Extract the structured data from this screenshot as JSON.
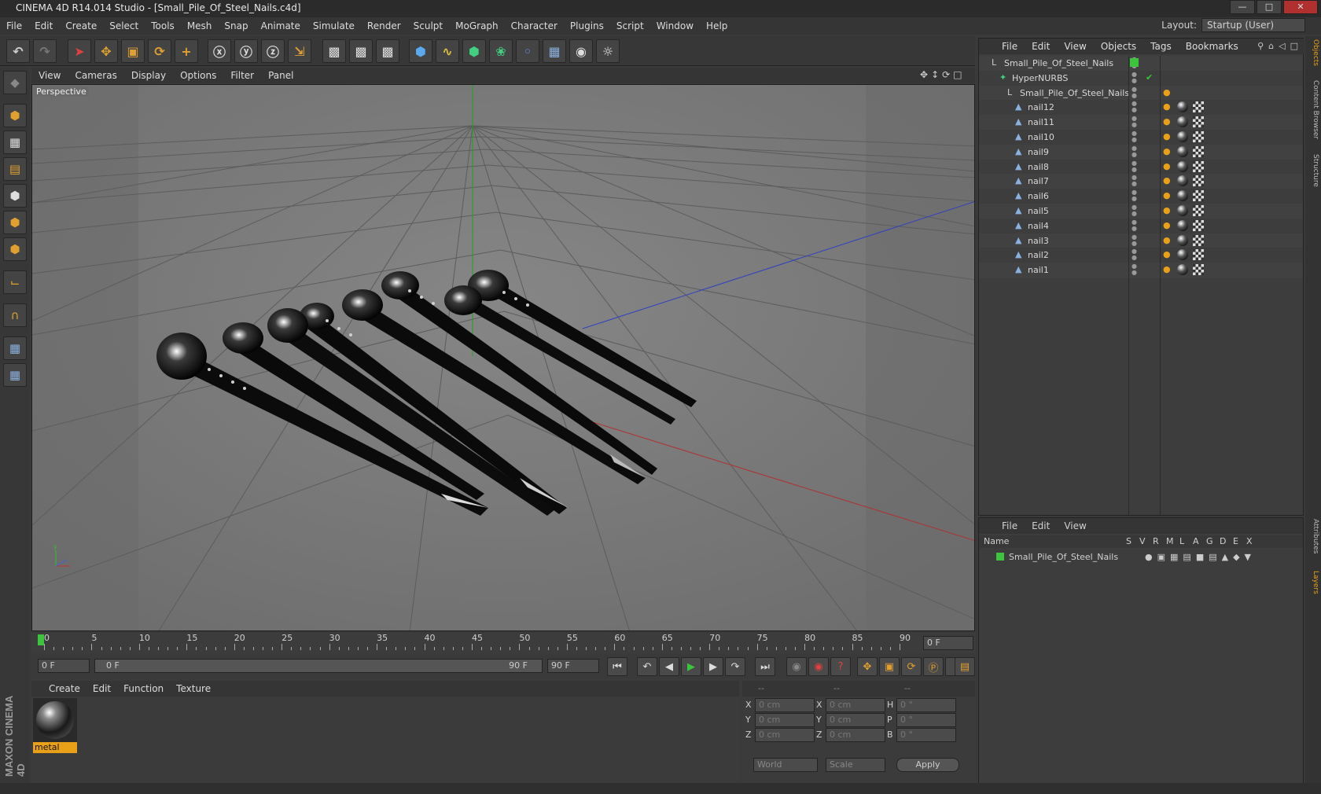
{
  "title": "CINEMA 4D R14.014 Studio - [Small_Pile_Of_Steel_Nails.c4d]",
  "menu": [
    "File",
    "Edit",
    "Create",
    "Select",
    "Tools",
    "Mesh",
    "Snap",
    "Animate",
    "Simulate",
    "Render",
    "Sculpt",
    "MoGraph",
    "Character",
    "Plugins",
    "Script",
    "Window",
    "Help"
  ],
  "layout": {
    "label": "Layout:",
    "value": "Startup (User)"
  },
  "viewport": {
    "menu": [
      "View",
      "Cameras",
      "Display",
      "Options",
      "Filter",
      "Panel"
    ],
    "label": "Perspective"
  },
  "timeline": {
    "ticks": [
      "0",
      "5",
      "10",
      "15",
      "20",
      "25",
      "30",
      "35",
      "40",
      "45",
      "50",
      "55",
      "60",
      "65",
      "70",
      "75",
      "80",
      "85",
      "90"
    ],
    "current_frame": "0 F"
  },
  "playback": {
    "start": "0 F",
    "range_start": "0 F",
    "range_end": "90 F",
    "end": "90 F"
  },
  "materials": {
    "menu": [
      "Create",
      "Edit",
      "Function",
      "Texture"
    ],
    "items": [
      {
        "name": "metal"
      }
    ]
  },
  "coords": {
    "headers": [
      "--",
      "--",
      "--"
    ],
    "rows": [
      {
        "a": "X",
        "av": "0 cm",
        "b": "X",
        "bv": "0 cm",
        "c": "H",
        "cv": "0 °"
      },
      {
        "a": "Y",
        "av": "0 cm",
        "b": "Y",
        "bv": "0 cm",
        "c": "P",
        "cv": "0 °"
      },
      {
        "a": "Z",
        "av": "0 cm",
        "b": "Z",
        "bv": "0 cm",
        "c": "B",
        "cv": "0 °"
      }
    ],
    "world": "World",
    "scale": "Scale",
    "apply": "Apply"
  },
  "objects": {
    "menu": [
      "File",
      "Edit",
      "View",
      "Objects",
      "Tags",
      "Bookmarks"
    ],
    "tree": [
      {
        "name": "Small_Pile_Of_Steel_Nails",
        "level": 0
      },
      {
        "name": "HyperNURBS",
        "level": 1
      },
      {
        "name": "Small_Pile_Of_Steel_Nails",
        "level": 2
      },
      {
        "name": "nail12",
        "level": 3
      },
      {
        "name": "nail11",
        "level": 3
      },
      {
        "name": "nail10",
        "level": 3
      },
      {
        "name": "nail9",
        "level": 3
      },
      {
        "name": "nail8",
        "level": 3
      },
      {
        "name": "nail7",
        "level": 3
      },
      {
        "name": "nail6",
        "level": 3
      },
      {
        "name": "nail5",
        "level": 3
      },
      {
        "name": "nail4",
        "level": 3
      },
      {
        "name": "nail3",
        "level": 3
      },
      {
        "name": "nail2",
        "level": 3
      },
      {
        "name": "nail1",
        "level": 3
      }
    ]
  },
  "layers": {
    "menu": [
      "File",
      "Edit",
      "View"
    ],
    "columns": [
      "Name",
      "S",
      "V",
      "R",
      "M",
      "L",
      "A",
      "G",
      "D",
      "E",
      "X"
    ],
    "rows": [
      {
        "name": "Small_Pile_Of_Steel_Nails"
      }
    ]
  },
  "right_tabs": [
    "Objects",
    "Content Browser",
    "Structure",
    "Attributes",
    "Layers"
  ],
  "branding": "MAXON CINEMA 4D",
  "colors": {
    "accent": "#e8a018",
    "layer_green": "#3cc43c",
    "x_axis": "#b03030",
    "y_axis": "#20a020",
    "z_axis": "#3040c0"
  }
}
